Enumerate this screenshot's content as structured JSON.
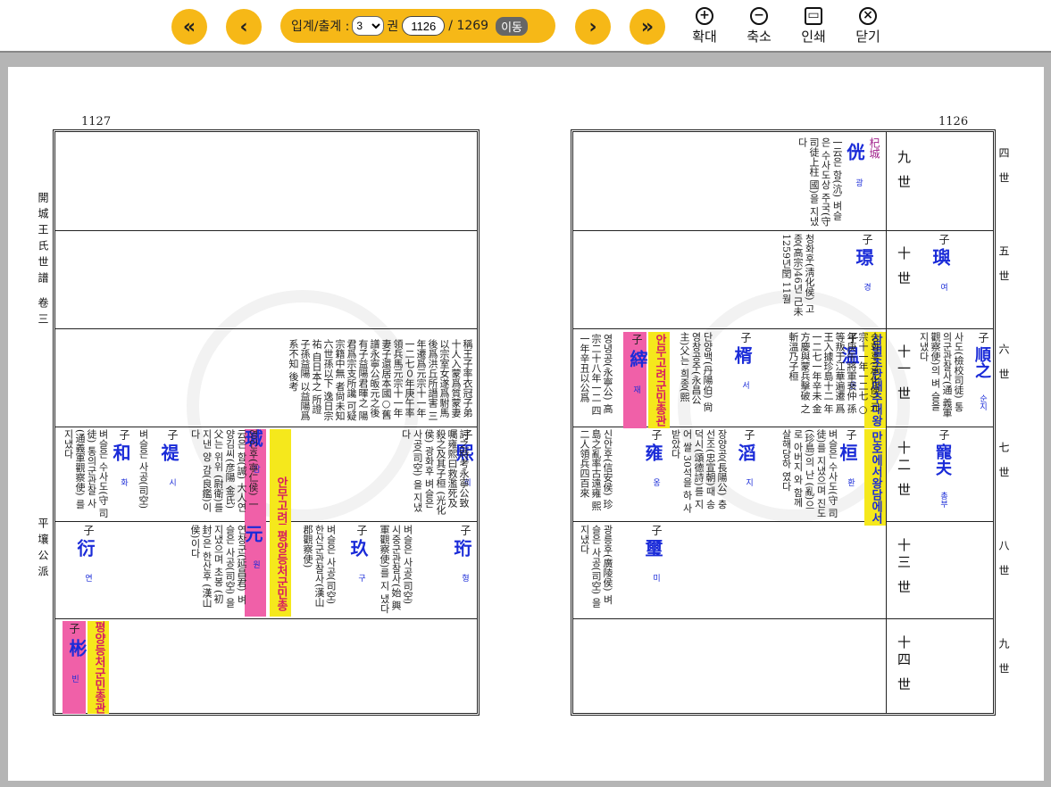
{
  "toolbar": {
    "first_icon": "«",
    "prev_icon": "‹",
    "next_icon": "›",
    "last_icon": "»",
    "page_label": "입계/출계 :",
    "volume": "3",
    "volume_suffix": "권",
    "page": "1126",
    "total": "/ 1269",
    "go": "이동",
    "zoom_in": "확대",
    "zoom_out": "축소",
    "print": "인쇄",
    "close": "닫기"
  },
  "left_page": {
    "number": "1127",
    "side_title": "開城王氏世譜 卷三",
    "side_branch": "平壤公派",
    "text_block": "稱王子率衣冠子弟 十人入蒙爲質蒙妻 以宗室女遂爲駙馬 後爲洪丘所譖害 三年遷爲元宗十一年 一二七０年庚午率 領兵馬元宗十一年 妻子還居本國○舊 譜永寧公皈元之後 有子益陽君暉之 陽君爲宗支所讒 可疑宗籍中無 者尙未知 六世孫以下 逸日宗祐 自日本之 所證 子孫益陽 以益陽爲 系不知 後考",
    "row4": [
      {
        "name": "熙",
        "hanja": "희",
        "title": "子",
        "text": "討之時考永寧公致 囑雍熙曰救濫死及 殺之及其子桓 (光化侯) 광화후 벼슬은 사공(司空) 을 지냈다"
      },
      {
        "name": "瑊",
        "hanja": "감",
        "title": "子",
        "tag": "안무고려군민총관",
        "text": "영인후(寧仁侯) 一云은 함(諴) 大人연양김씨(彦陽 金氏) 父는 위위 (尉衛)를 지낸 양 감(良鑑)이다"
      },
      {
        "name": "禔",
        "hanja": "시",
        "title": "子",
        "text": "벼슬은 사공(司空)"
      },
      {
        "name": "和",
        "hanja": "화",
        "title": "子",
        "text": "벼슬은 수사도(守 司徒) 통의군관찰 사(通義軍觀察使) 를 지냈다"
      }
    ],
    "row5": [
      {
        "name": "珩",
        "hanja": "형",
        "title": "子",
        "text": "벼슬은 사공(司空) 시중군관찰사(始 興軍觀察使)를 지 냈다"
      },
      {
        "name": "玖",
        "hanja": "구",
        "title": "子",
        "text": "벼슬은 사공(司空) 한산군관찰사(漢山 郡觀察使)"
      },
      {
        "name": "元",
        "hanja": "원",
        "title": "子",
        "tag": "평양등처군민총관",
        "text": "연창군(延昌君) 벼슬은 사공(司空) 을 지냈으며 초봉 (初封)은 한산후 (漢山侯)이다"
      },
      {
        "name": "衍",
        "hanja": "연",
        "title": "子",
        "text": ""
      }
    ],
    "row6": [
      {
        "name": "彬",
        "hanja": "빈",
        "title": "子",
        "tag": "평양등처군민총관",
        "text": ""
      }
    ]
  },
  "right_page": {
    "number": "1126",
    "gens": [
      "九 世",
      "十 世",
      "十一 世",
      "十二 世",
      "十三 世",
      "十四 世"
    ],
    "side_gens": [
      "四 世",
      "五 世",
      "六 世",
      "七 世",
      "八 世",
      "九 世"
    ],
    "row1": {
      "name": "侊",
      "hanja": "광",
      "title": "杞城",
      "text": "一云은 항(沆) 벼슬은 수사도상 주국(守司徒上柱 國)을 지냈다"
    },
    "row2": [
      {
        "name": "璵",
        "hanja": "여",
        "title": "子",
        "text": ""
      },
      {
        "name": "璟",
        "hanja": "경",
        "title": "子",
        "text": "청화후(淸化侯) 고종(高宗)46년 己未1259년閏 11월"
      }
    ],
    "row3": [
      {
        "name": "順之",
        "hanja": "순지",
        "title": "子",
        "text": "사도(檢校司徒) 통의군관찰사(通 義軍觀察使)의 벼 슬을 지냈다"
      },
      {
        "name": "温",
        "hanja": "온",
        "title": "子",
        "tag": "삼별초란때추대왕",
        "text": "승화후(承化侯) 元宗十一年一二七 ○年庚午將軍裵仲 孫等叛于江華遍遷 爲王入據珍島十二 年一二七一年辛未 金方慶與蒙兵擊破 之斬溫乃子桓"
      },
      {
        "name": "楈",
        "hanja": "서",
        "title": "子",
        "text": "단양백(丹陽伯) 尙영창공주(永昌公 主)父는 희종(熙"
      },
      {
        "name": "縡",
        "hanja": "재",
        "title": "子",
        "tag": "안무고려군민총관",
        "text": "영녕공(永寧公) 高宗二十八年一二 四一年辛丑以公爲"
      }
    ],
    "row4": [
      {
        "name": "寵夫",
        "hanja": "총부",
        "title": "子",
        "tag": "만호에서왕담에서봉",
        "text": ""
      },
      {
        "name": "桓",
        "hanja": "환",
        "title": "子",
        "text": "벼슬은 수사도(守 司徒)를 지냈으며 진도(珍島)의 난 (亂)으로 아버지 와 함께 살해당하 였다"
      },
      {
        "name": "滔",
        "hanja": "지",
        "title": "子",
        "text": "장양공(長陽公) 충선조(忠宣朝)때 송덕시(頌德詩)를 지어 쌀 30석을 하 사받았다"
      },
      {
        "name": "雍",
        "hanja": "옹",
        "title": "子",
        "text": "신안후(信安侯) 珍島之亂率古遠雍 熙二人領兵四百來"
      }
    ],
    "row5": [
      {
        "name": "璽",
        "hanja": "미",
        "title": "子",
        "text": "광릉후(廣陵侯) 벼슬은 사공(司空) 을 지냈다"
      }
    ]
  }
}
